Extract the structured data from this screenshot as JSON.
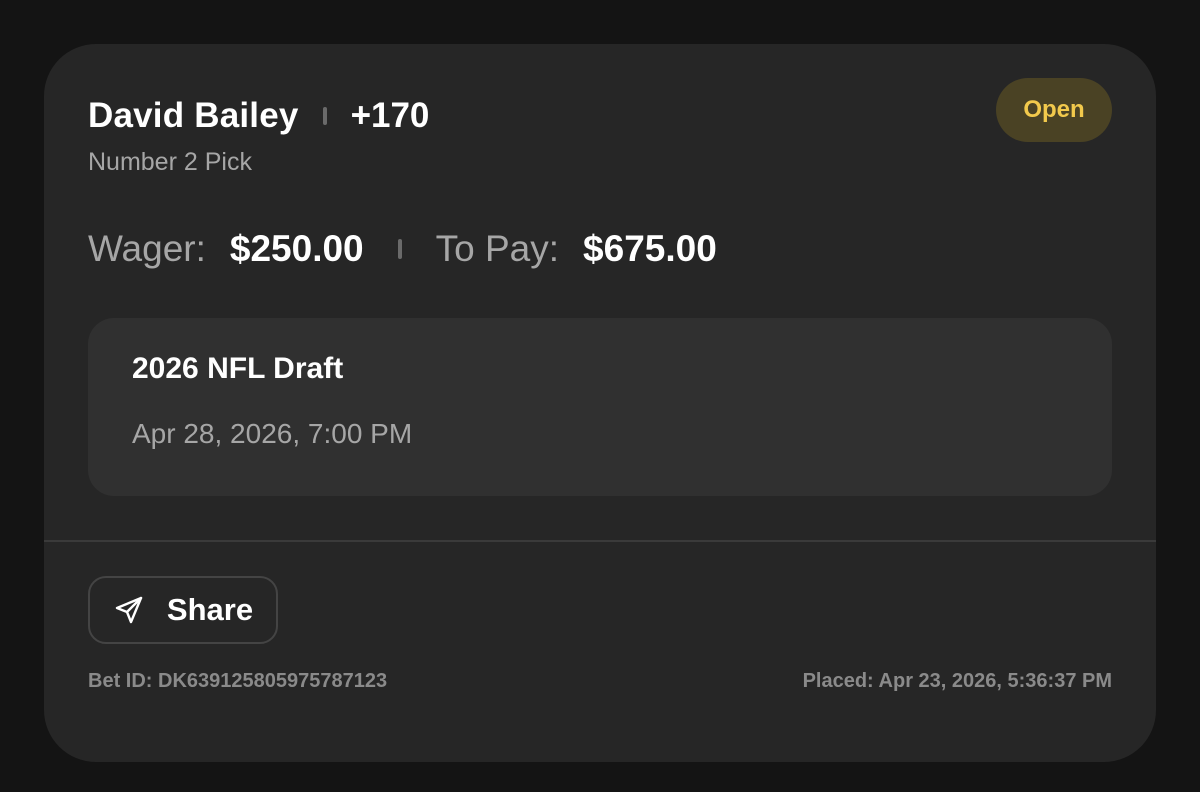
{
  "bet": {
    "selection": "David Bailey",
    "odds": "+170",
    "market": "Number 2 Pick",
    "status": "Open"
  },
  "amounts": {
    "wager_label": "Wager:",
    "wager_value": "$250.00",
    "topay_label": "To Pay:",
    "topay_value": "$675.00"
  },
  "event": {
    "name": "2026 NFL Draft",
    "datetime": "Apr 28, 2026, 7:00 PM"
  },
  "actions": {
    "share_label": "Share",
    "share_icon": "send-icon"
  },
  "footer": {
    "bet_id": "Bet ID: DK639125805975787123",
    "placed": "Placed: Apr 23, 2026, 5:36:37 PM"
  },
  "colors": {
    "background": "#141414",
    "card": "#262626",
    "event_box": "#303030",
    "status_badge_bg": "#4a4224",
    "status_badge_text": "#f2c94c",
    "primary_text": "#ffffff",
    "secondary_text": "#a6a6a6"
  }
}
